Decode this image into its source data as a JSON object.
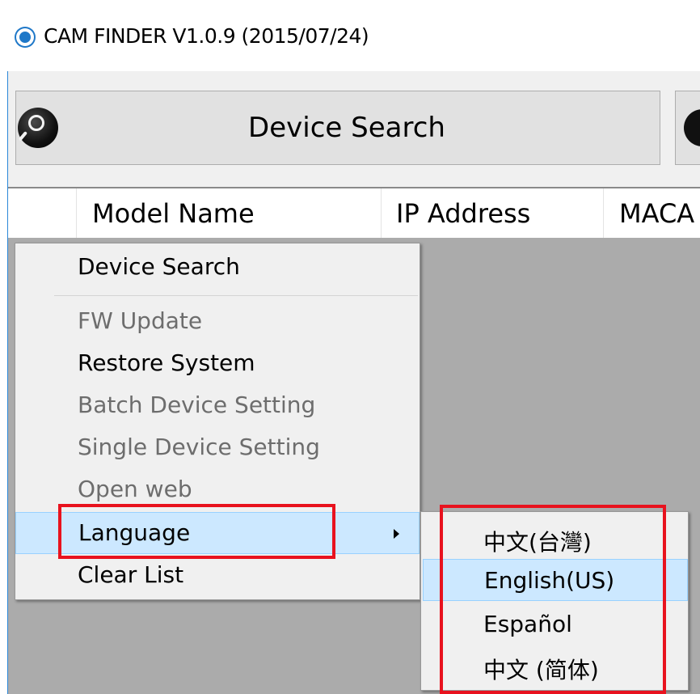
{
  "window": {
    "title": "CAM FINDER V1.0.9 (2015/07/24)"
  },
  "toolbar": {
    "device_search_label": "Device Search"
  },
  "grid": {
    "columns": [
      "Model Name",
      "IP Address",
      "MACA"
    ]
  },
  "context_menu": {
    "items": [
      {
        "label": "Device Search",
        "enabled": true
      },
      {
        "label": "FW Update",
        "enabled": false
      },
      {
        "label": "Restore System",
        "enabled": true
      },
      {
        "label": "Batch Device Setting",
        "enabled": false
      },
      {
        "label": "Single Device Setting",
        "enabled": false
      },
      {
        "label": "Open web",
        "enabled": false
      },
      {
        "label": "Language",
        "enabled": true,
        "has_submenu": true,
        "highlighted": true
      },
      {
        "label": "Clear List",
        "enabled": true
      }
    ]
  },
  "language_submenu": {
    "items": [
      {
        "label": "中文(台灣)",
        "highlighted": false
      },
      {
        "label": "English(US)",
        "highlighted": true
      },
      {
        "label": "Español",
        "highlighted": false
      },
      {
        "label": "中文 (简体)",
        "highlighted": false
      }
    ]
  },
  "colors": {
    "accent": "#1f78c8",
    "highlight_bg": "#cce8ff",
    "annotation_red": "#e8121e",
    "grid_bg": "#ababab",
    "menu_bg": "#f0f0f0"
  }
}
